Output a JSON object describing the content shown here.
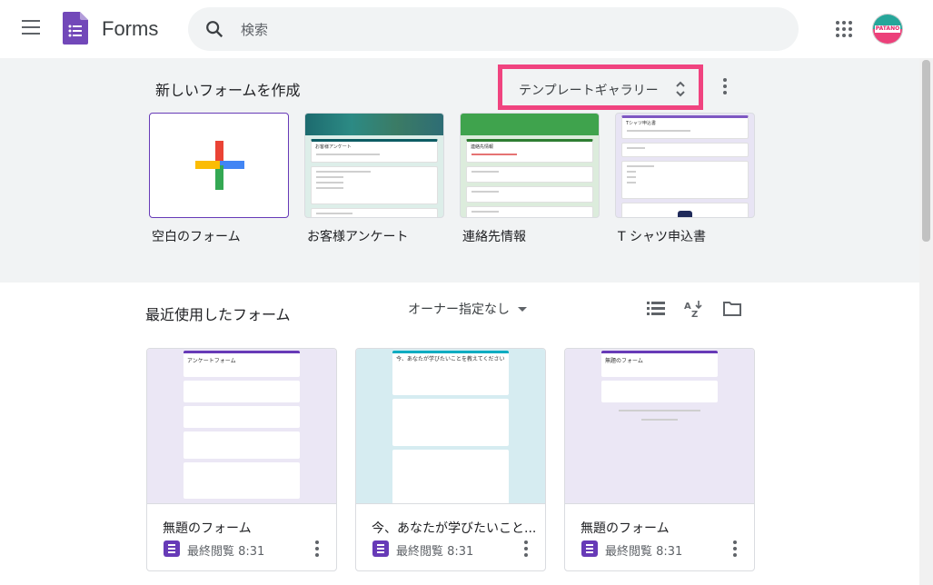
{
  "header": {
    "app_name": "Forms",
    "search_placeholder": "検索",
    "avatar_text": "PATANO"
  },
  "gallery": {
    "title": "新しいフォームを作成",
    "toggle_label": "テンプレートギャラリー",
    "templates": [
      {
        "label": "空白のフォーム"
      },
      {
        "label": "お客様アンケート",
        "thumb_title": "お客様アンケート"
      },
      {
        "label": "連絡先情報",
        "thumb_title": "連絡先情報"
      },
      {
        "label": "T シャツ申込書",
        "thumb_title": "Tシャツ申込書"
      }
    ]
  },
  "recent": {
    "title": "最近使用したフォーム",
    "owner_filter": "オーナー指定なし",
    "forms": [
      {
        "title": "無題のフォーム",
        "date": "最終閲覧 8:31",
        "thumb_title": "アンケートフォーム"
      },
      {
        "title": "今、あなたが学びたいこと...",
        "date": "最終閲覧 8:31",
        "thumb_title": "今、あなたが学びたいことを教えてください"
      },
      {
        "title": "無題のフォーム",
        "date": "最終閲覧 8:31",
        "thumb_title": "無題のフォーム"
      }
    ]
  },
  "colors": {
    "accent": "#673ab7",
    "highlight": "#f0437f",
    "gallery_bg": "#f1f3f4"
  }
}
